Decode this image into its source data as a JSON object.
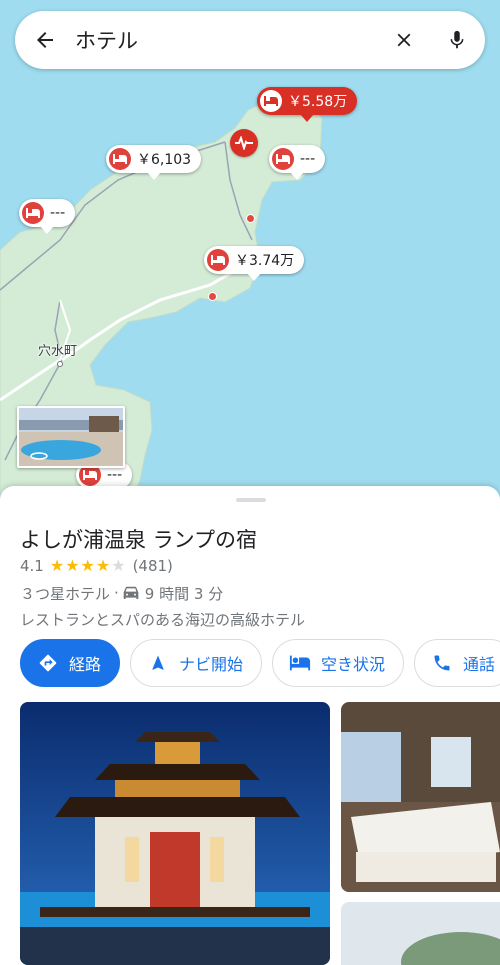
{
  "search": {
    "query": "ホテル"
  },
  "map": {
    "town_label": "穴水町",
    "pins": [
      {
        "label": "￥5.58万",
        "selected": true
      },
      {
        "label": "￥6,103",
        "selected": false
      },
      {
        "label": "---",
        "selected": false
      },
      {
        "label": "---",
        "selected": false
      },
      {
        "label": "￥3.74万",
        "selected": false
      },
      {
        "label": "---",
        "selected": false
      }
    ]
  },
  "place": {
    "name": "よしが浦温泉 ランプの宿",
    "rating": "4.1",
    "rating_value": 4.1,
    "review_count": "(481)",
    "category": "３つ星ホテル",
    "separator": "·",
    "drive_time": "9 時間 3 分",
    "description": "レストランとスパのある海辺の高級ホテル"
  },
  "actions": [
    {
      "label": "経路",
      "icon": "directions-icon"
    },
    {
      "label": "ナビ開始",
      "icon": "navigation-icon"
    },
    {
      "label": "空き状況",
      "icon": "bed-icon"
    },
    {
      "label": "通話",
      "icon": "phone-icon"
    }
  ],
  "colors": {
    "accent": "#1a73e8",
    "pin_red": "#d93025",
    "water": "#9fdcf0",
    "land": "#d4ecd6",
    "star": "#fbbc04"
  }
}
